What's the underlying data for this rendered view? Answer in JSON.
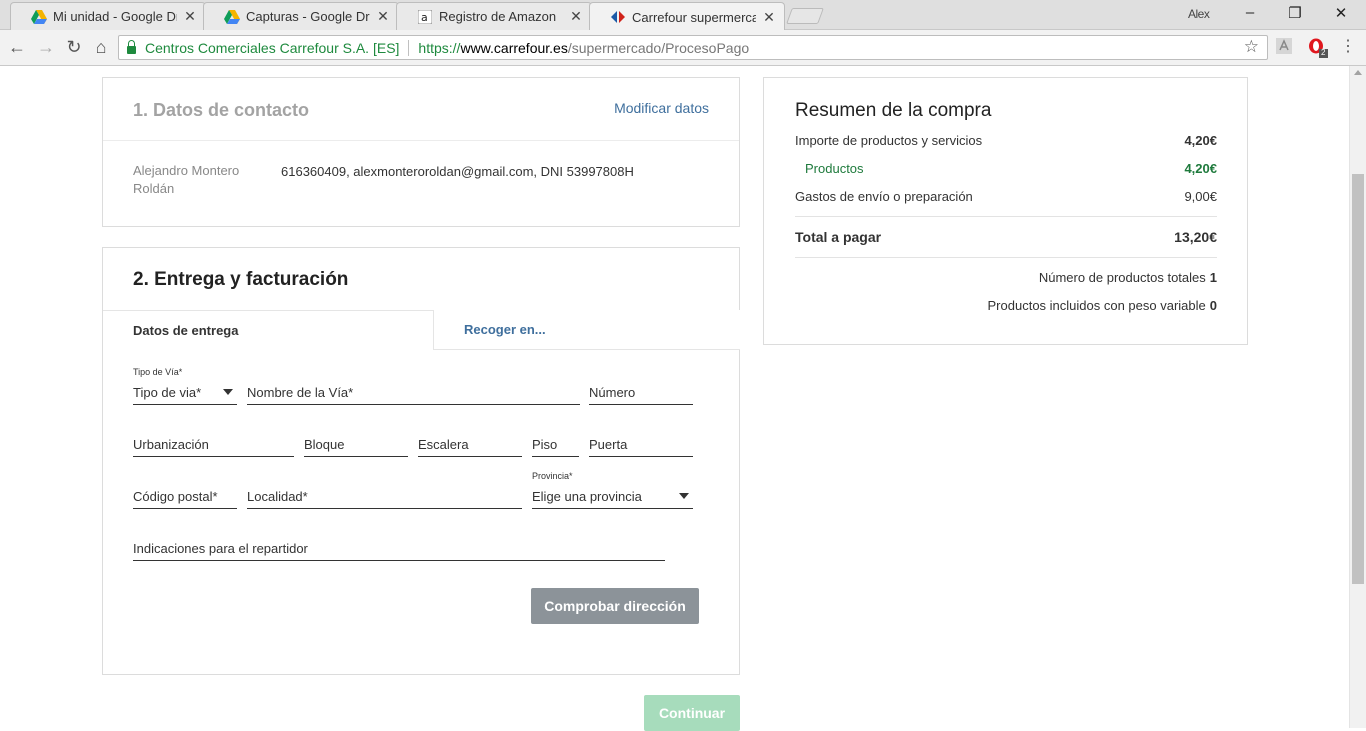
{
  "browser": {
    "tabs": [
      {
        "title": "Mi unidad - Google Drive",
        "close": "✕"
      },
      {
        "title": "Capturas - Google Drive",
        "close": "✕"
      },
      {
        "title": "Registro de Amazon",
        "close": "✕"
      },
      {
        "title": "Carrefour supermercado",
        "close": "✕"
      }
    ],
    "profile": "Alex",
    "window": {
      "minimize": "–",
      "restore": "❐",
      "close": "✕"
    },
    "nav": {
      "back": "←",
      "forward": "→",
      "reload": "↻",
      "home": "⌂"
    },
    "site_identity": "Centros Comerciales Carrefour S.A. [ES]",
    "url": {
      "scheme": "https://",
      "host": "www.carrefour.es",
      "path": "/supermercado/ProcesoPago"
    },
    "bookmark": "☆",
    "opera_badge": "2",
    "menu": "⋮"
  },
  "contact": {
    "heading": "1. Datos de contacto",
    "edit_link": "Modificar datos",
    "name_line1": "Alejandro Montero",
    "name_line2": "Roldán",
    "details": "616360409, alexmonteroroldan@gmail.com, DNI 53997808H"
  },
  "delivery": {
    "heading": "2. Entrega y facturación",
    "tabs": {
      "delivery": "Datos de entrega",
      "pickup": "Recoger en..."
    },
    "fields": {
      "street_type_label": "Tipo de Vía*",
      "street_type_value": "Tipo de via*",
      "street_name": "Nombre de la Vía*",
      "number": "Número",
      "urbanization": "Urbanización",
      "block": "Bloque",
      "staircase": "Escalera",
      "floor": "Piso",
      "door": "Puerta",
      "postal_code": "Código postal*",
      "locality": "Localidad*",
      "province_label": "Provincia*",
      "province_value": "Elige una provincia",
      "instructions": "Indicaciones para el repartidor"
    },
    "check_button": "Comprobar dirección"
  },
  "continue_button": "Continuar",
  "summary": {
    "heading": "Resumen de la compra",
    "products_services_label": "Importe de productos y servicios",
    "products_services_value": "4,20€",
    "products_label": "Productos",
    "products_value": "4,20€",
    "shipping_label": "Gastos de envío o preparación",
    "shipping_value": "9,00€",
    "total_label": "Total a pagar",
    "total_value": "13,20€",
    "total_products_label": "Número de productos totales",
    "total_products_value": "1",
    "variable_weight_label": "Productos incluidos con peso variable",
    "variable_weight_value": "0"
  },
  "colors": {
    "green_accent": "#1e7a3c",
    "link": "#3f6f9d",
    "button_gray": "#8c9399",
    "button_green": "#a7dcbc"
  }
}
